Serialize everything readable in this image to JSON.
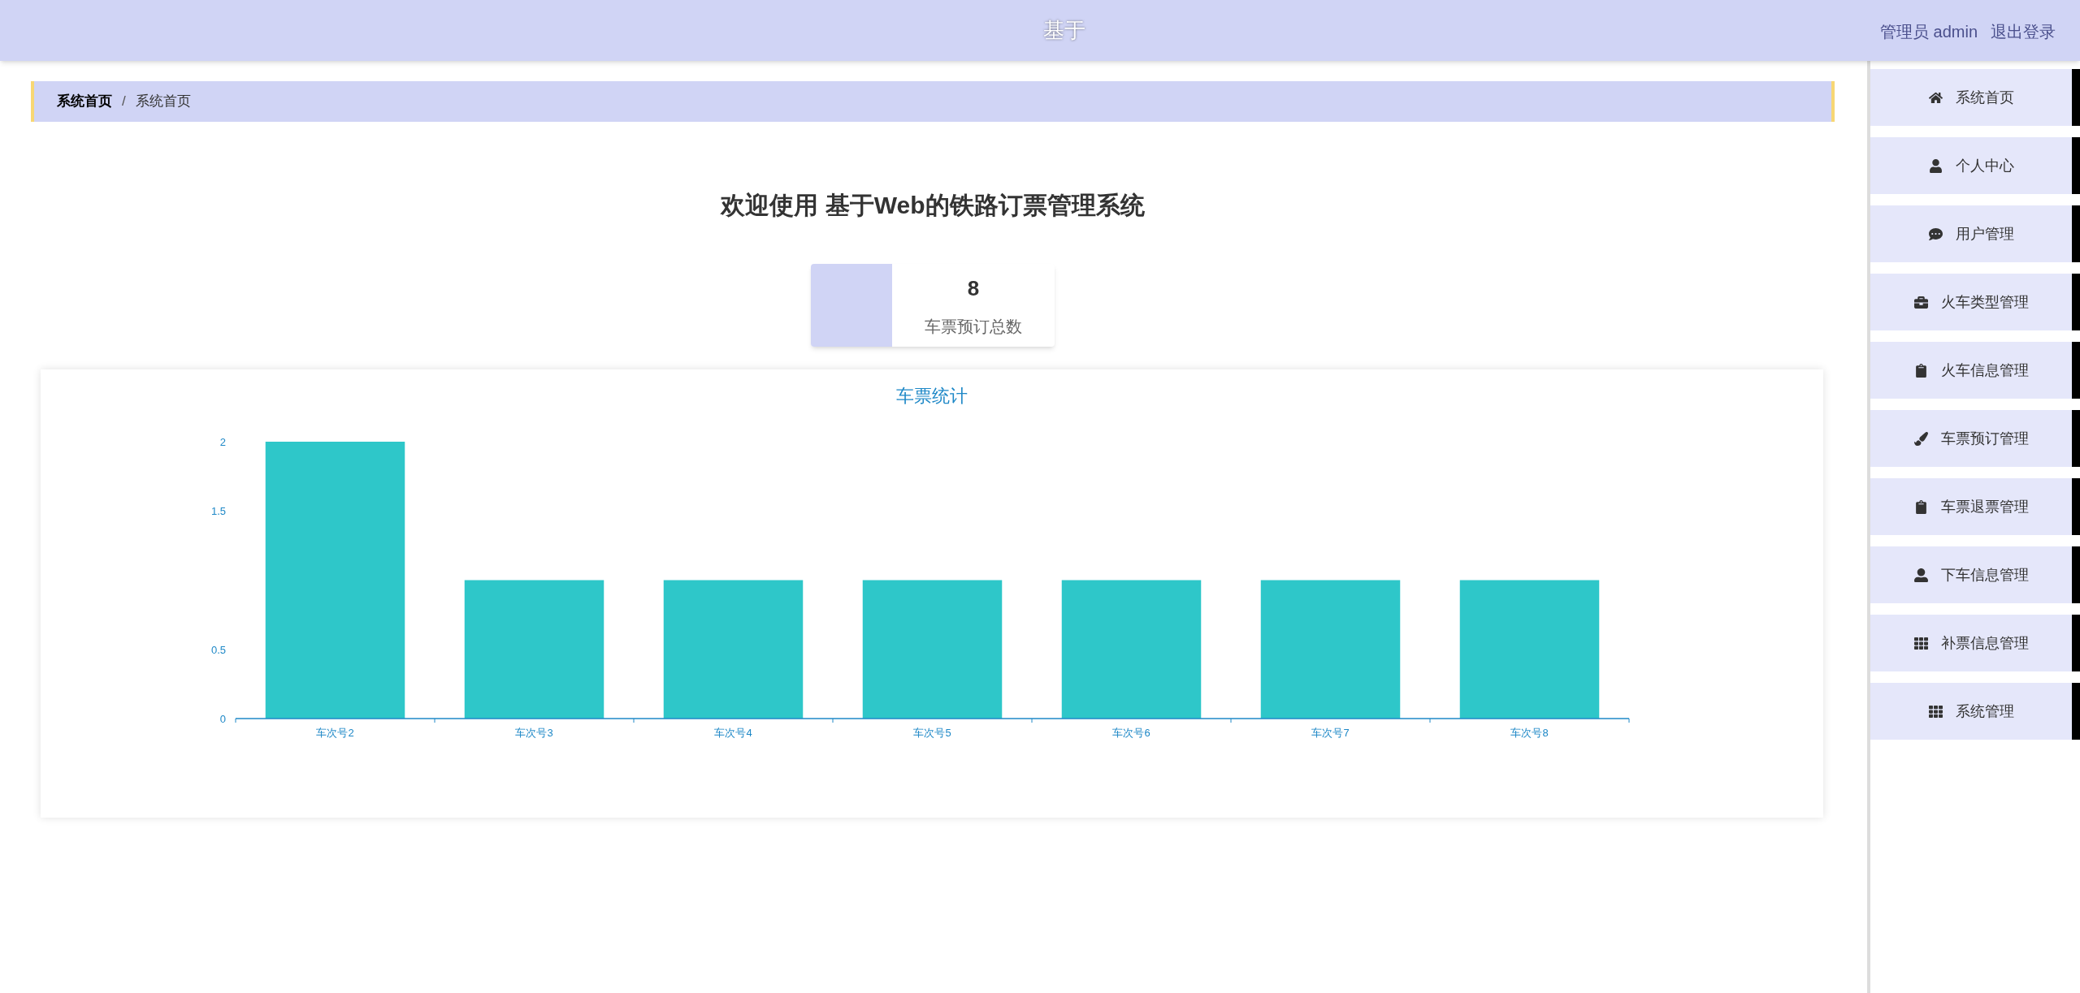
{
  "header": {
    "title": "基于",
    "user_label": "管理员 admin",
    "logout": "退出登录"
  },
  "breadcrumb": {
    "link": "系统首页",
    "separator": "/",
    "current": "系统首页"
  },
  "welcome": "欢迎使用 基于Web的铁路订票管理系统",
  "stat_card": {
    "value": "8",
    "label": "车票预订总数"
  },
  "chart_panel": {
    "chart_data": {
      "type": "bar",
      "title": "车票统计",
      "categories": [
        "车次号2",
        "车次号3",
        "车次号4",
        "车次号5",
        "车次号6",
        "车次号7",
        "车次号8"
      ],
      "values": [
        2,
        1,
        1,
        1,
        1,
        1,
        1
      ],
      "ylim": [
        0,
        2
      ],
      "yticks": [
        0,
        0.5,
        1.5,
        2
      ]
    }
  },
  "sidebar": {
    "items": [
      {
        "label": "系统首页"
      },
      {
        "label": "个人中心"
      },
      {
        "label": "用户管理"
      },
      {
        "label": "火车类型管理"
      },
      {
        "label": "火车信息管理"
      },
      {
        "label": "车票预订管理"
      },
      {
        "label": "车票退票管理"
      },
      {
        "label": "下车信息管理"
      },
      {
        "label": "补票信息管理"
      },
      {
        "label": "系统管理"
      }
    ]
  }
}
